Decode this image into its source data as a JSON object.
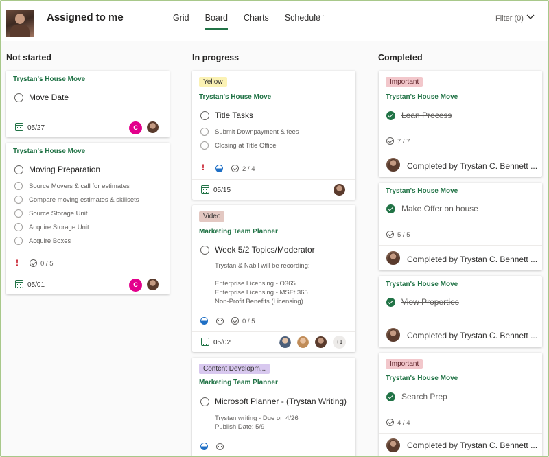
{
  "header": {
    "title": "Assigned to me",
    "tabs": [
      "Grid",
      "Board",
      "Charts",
      "Schedule"
    ],
    "active_tab": "Board",
    "more": "···",
    "filter": "Filter (0)"
  },
  "columns": {
    "not_started": "Not started",
    "in_progress": "In progress",
    "completed": "Completed"
  },
  "cards": {
    "ns1": {
      "plan": "Trystan's House Move",
      "title": "Move Date",
      "date": "05/27",
      "initial": "C"
    },
    "ns2": {
      "plan": "Trystan's House Move",
      "title": "Moving Preparation",
      "items": [
        "Source Movers & call for estimates",
        "Compare moving estimates & skillsets",
        "Source Storage Unit",
        "Acquire Storage Unit",
        "Acquire Boxes"
      ],
      "urgent": "!",
      "checklist": "0 / 5",
      "date": "05/01",
      "initial": "C"
    },
    "ip1": {
      "label": "Yellow",
      "plan": "Trystan's House Move",
      "title": "Title Tasks",
      "items": [
        "Submit Downpayment & fees",
        "Closing at Title Office"
      ],
      "urgent": "!",
      "checklist": "2 / 4",
      "date": "05/15"
    },
    "ip2": {
      "label": "Video",
      "plan": "Marketing Team Planner",
      "title": "Week 5/2 Topics/Moderator",
      "desc": [
        "Trystan & Nabil will be recording:",
        "",
        "Enterprise Licensing - O365",
        "Enterprise Licensing - MSFt 365",
        "Non-Profit Benefits (Licensing)..."
      ],
      "checklist": "0 / 5",
      "date": "05/02",
      "plus": "+1"
    },
    "ip3": {
      "label": "Content Developm...",
      "plan": "Marketing Team Planner",
      "title": "Microsoft Planner - (Trystan Writing)",
      "desc": [
        "Trystan writing - Due on 4/26",
        "Publish Date: 5/9"
      ]
    },
    "c1": {
      "label": "Important",
      "plan": "Trystan's House Move",
      "title": "Loan Process",
      "checklist": "7 / 7",
      "completed_by": "Completed by Trystan C. Bennett ..."
    },
    "c2": {
      "plan": "Trystan's House Move",
      "title": "Make Offer on house",
      "checklist": "5 / 5",
      "completed_by": "Completed by Trystan C. Bennett ..."
    },
    "c3": {
      "plan": "Trystan's House Move",
      "title": "View Properties",
      "completed_by": "Completed by Trystan C. Bennett ..."
    },
    "c4": {
      "label": "Important",
      "plan": "Trystan's House Move",
      "title": "Search Prep",
      "checklist": "4 / 4",
      "completed_by": "Completed by Trystan C. Bennett ..."
    }
  },
  "colors": {
    "accent": "#217346",
    "urgent": "#c50f1f",
    "initial_badge": "#e3008c"
  }
}
